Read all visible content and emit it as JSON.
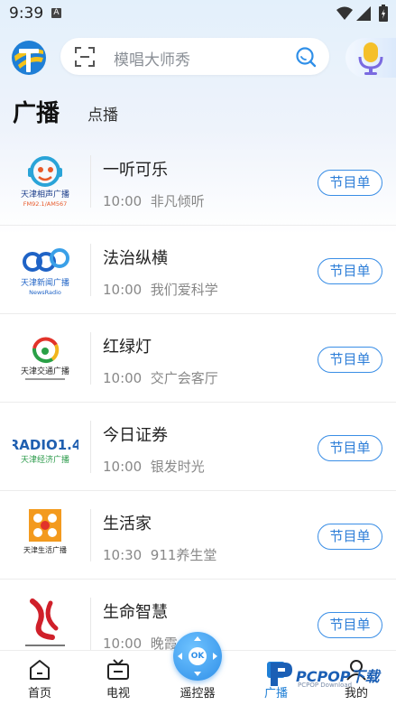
{
  "status_bar": {
    "time": "9:39",
    "notif_letter": "A"
  },
  "search": {
    "placeholder": "模唱大师秀"
  },
  "tabs": {
    "active": "广播",
    "other": "点播"
  },
  "stations": [
    {
      "logo_text": "天津相声广播",
      "logo_sub": "FM92.1/AM567",
      "name": "一听可乐",
      "time": "10:00",
      "program": "非凡倾听",
      "button": "节目单"
    },
    {
      "logo_text": "天津新闻广播",
      "logo_sub": "NewsRadio",
      "name": "法治纵横",
      "time": "10:00",
      "program": "我们爱科学",
      "button": "节目单"
    },
    {
      "logo_text": "天津交通广播",
      "logo_sub": "",
      "name": "红绿灯",
      "time": "10:00",
      "program": "交广会客厅",
      "button": "节目单"
    },
    {
      "logo_text": "天津经济广播",
      "logo_sub": "RADIO1.4",
      "name": "今日证券",
      "time": "10:00",
      "program": "银发时光",
      "button": "节目单"
    },
    {
      "logo_text": "天津生活广播",
      "logo_sub": "",
      "name": "生活家",
      "time": "10:30",
      "program": "911养生堂",
      "button": "节目单"
    },
    {
      "logo_text": "",
      "logo_sub": "",
      "name": "生命智慧",
      "time": "10:00",
      "program": "晚霞",
      "button": "节目单"
    }
  ],
  "bottom_nav": {
    "home": "首页",
    "tv": "电视",
    "remote": "遥控器",
    "radio": "广播",
    "mine": "我的",
    "ok": "OK"
  },
  "watermark": {
    "title": "PCPOP下载",
    "sub": "PCPOP Download"
  },
  "colors": {
    "accent": "#2f7fd8",
    "background_top": "#e3f0fb"
  }
}
